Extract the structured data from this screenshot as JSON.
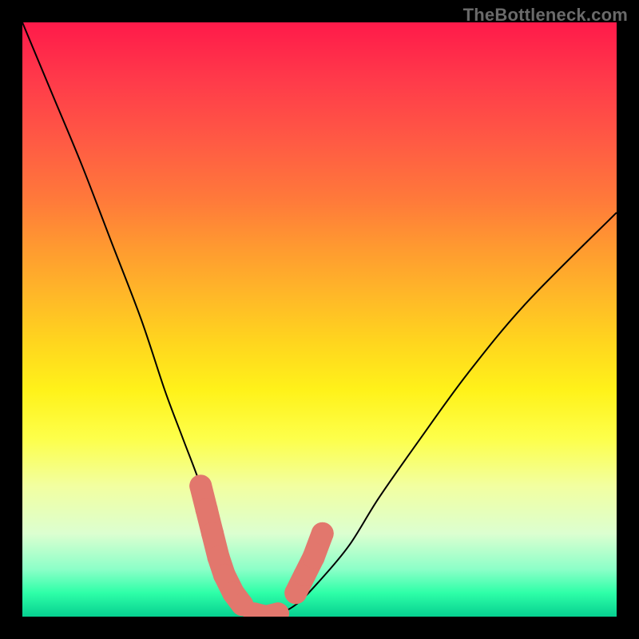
{
  "watermark": "TheBottleneck.com",
  "colors": {
    "background": "#000000",
    "curve_stroke": "#000000",
    "marker_fill": "#e2776d",
    "gradient_top": "#ff1a4a",
    "gradient_bottom": "#06d090"
  },
  "chart_data": {
    "type": "line",
    "title": "",
    "xlabel": "",
    "ylabel": "",
    "xlim": [
      0,
      100
    ],
    "ylim": [
      0,
      100
    ],
    "grid": false,
    "series": [
      {
        "name": "bottleneck-curve",
        "x": [
          0,
          5,
          10,
          15,
          20,
          24,
          27,
          30,
          32,
          34,
          36,
          38,
          40,
          42,
          46,
          50,
          55,
          60,
          67,
          75,
          85,
          100
        ],
        "y": [
          100,
          88,
          76,
          63,
          50,
          38,
          30,
          22,
          15,
          8,
          4,
          1,
          0,
          0,
          2,
          6,
          12,
          20,
          30,
          41,
          53,
          68
        ]
      }
    ],
    "markers": {
      "name": "highlight-segments",
      "left": [
        {
          "x": 30.0,
          "y": 22
        },
        {
          "x": 31.0,
          "y": 18
        },
        {
          "x": 32.0,
          "y": 14
        },
        {
          "x": 33.0,
          "y": 10
        },
        {
          "x": 34.0,
          "y": 7
        },
        {
          "x": 35.5,
          "y": 4
        },
        {
          "x": 37.0,
          "y": 2
        }
      ],
      "bottom": [
        {
          "x": 39.0,
          "y": 0.5
        },
        {
          "x": 41.0,
          "y": 0
        },
        {
          "x": 43.0,
          "y": 0.5
        }
      ],
      "right": [
        {
          "x": 46.0,
          "y": 4
        },
        {
          "x": 47.5,
          "y": 7
        },
        {
          "x": 49.0,
          "y": 10
        },
        {
          "x": 50.5,
          "y": 14
        }
      ]
    }
  }
}
